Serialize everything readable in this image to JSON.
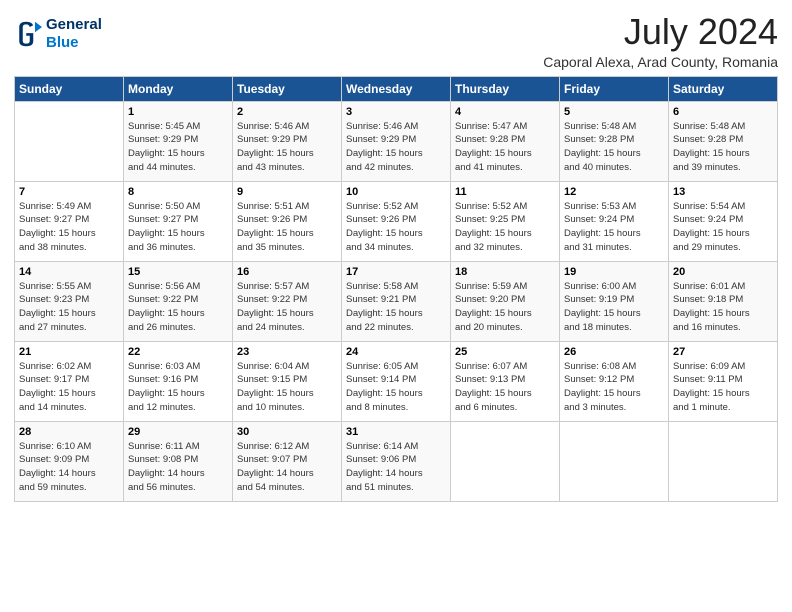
{
  "logo": {
    "line1": "General",
    "line2": "Blue"
  },
  "title": "July 2024",
  "location": "Caporal Alexa, Arad County, Romania",
  "weekdays": [
    "Sunday",
    "Monday",
    "Tuesday",
    "Wednesday",
    "Thursday",
    "Friday",
    "Saturday"
  ],
  "weeks": [
    [
      {
        "day": "",
        "info": ""
      },
      {
        "day": "1",
        "info": "Sunrise: 5:45 AM\nSunset: 9:29 PM\nDaylight: 15 hours\nand 44 minutes."
      },
      {
        "day": "2",
        "info": "Sunrise: 5:46 AM\nSunset: 9:29 PM\nDaylight: 15 hours\nand 43 minutes."
      },
      {
        "day": "3",
        "info": "Sunrise: 5:46 AM\nSunset: 9:29 PM\nDaylight: 15 hours\nand 42 minutes."
      },
      {
        "day": "4",
        "info": "Sunrise: 5:47 AM\nSunset: 9:28 PM\nDaylight: 15 hours\nand 41 minutes."
      },
      {
        "day": "5",
        "info": "Sunrise: 5:48 AM\nSunset: 9:28 PM\nDaylight: 15 hours\nand 40 minutes."
      },
      {
        "day": "6",
        "info": "Sunrise: 5:48 AM\nSunset: 9:28 PM\nDaylight: 15 hours\nand 39 minutes."
      }
    ],
    [
      {
        "day": "7",
        "info": "Sunrise: 5:49 AM\nSunset: 9:27 PM\nDaylight: 15 hours\nand 38 minutes."
      },
      {
        "day": "8",
        "info": "Sunrise: 5:50 AM\nSunset: 9:27 PM\nDaylight: 15 hours\nand 36 minutes."
      },
      {
        "day": "9",
        "info": "Sunrise: 5:51 AM\nSunset: 9:26 PM\nDaylight: 15 hours\nand 35 minutes."
      },
      {
        "day": "10",
        "info": "Sunrise: 5:52 AM\nSunset: 9:26 PM\nDaylight: 15 hours\nand 34 minutes."
      },
      {
        "day": "11",
        "info": "Sunrise: 5:52 AM\nSunset: 9:25 PM\nDaylight: 15 hours\nand 32 minutes."
      },
      {
        "day": "12",
        "info": "Sunrise: 5:53 AM\nSunset: 9:24 PM\nDaylight: 15 hours\nand 31 minutes."
      },
      {
        "day": "13",
        "info": "Sunrise: 5:54 AM\nSunset: 9:24 PM\nDaylight: 15 hours\nand 29 minutes."
      }
    ],
    [
      {
        "day": "14",
        "info": "Sunrise: 5:55 AM\nSunset: 9:23 PM\nDaylight: 15 hours\nand 27 minutes."
      },
      {
        "day": "15",
        "info": "Sunrise: 5:56 AM\nSunset: 9:22 PM\nDaylight: 15 hours\nand 26 minutes."
      },
      {
        "day": "16",
        "info": "Sunrise: 5:57 AM\nSunset: 9:22 PM\nDaylight: 15 hours\nand 24 minutes."
      },
      {
        "day": "17",
        "info": "Sunrise: 5:58 AM\nSunset: 9:21 PM\nDaylight: 15 hours\nand 22 minutes."
      },
      {
        "day": "18",
        "info": "Sunrise: 5:59 AM\nSunset: 9:20 PM\nDaylight: 15 hours\nand 20 minutes."
      },
      {
        "day": "19",
        "info": "Sunrise: 6:00 AM\nSunset: 9:19 PM\nDaylight: 15 hours\nand 18 minutes."
      },
      {
        "day": "20",
        "info": "Sunrise: 6:01 AM\nSunset: 9:18 PM\nDaylight: 15 hours\nand 16 minutes."
      }
    ],
    [
      {
        "day": "21",
        "info": "Sunrise: 6:02 AM\nSunset: 9:17 PM\nDaylight: 15 hours\nand 14 minutes."
      },
      {
        "day": "22",
        "info": "Sunrise: 6:03 AM\nSunset: 9:16 PM\nDaylight: 15 hours\nand 12 minutes."
      },
      {
        "day": "23",
        "info": "Sunrise: 6:04 AM\nSunset: 9:15 PM\nDaylight: 15 hours\nand 10 minutes."
      },
      {
        "day": "24",
        "info": "Sunrise: 6:05 AM\nSunset: 9:14 PM\nDaylight: 15 hours\nand 8 minutes."
      },
      {
        "day": "25",
        "info": "Sunrise: 6:07 AM\nSunset: 9:13 PM\nDaylight: 15 hours\nand 6 minutes."
      },
      {
        "day": "26",
        "info": "Sunrise: 6:08 AM\nSunset: 9:12 PM\nDaylight: 15 hours\nand 3 minutes."
      },
      {
        "day": "27",
        "info": "Sunrise: 6:09 AM\nSunset: 9:11 PM\nDaylight: 15 hours\nand 1 minute."
      }
    ],
    [
      {
        "day": "28",
        "info": "Sunrise: 6:10 AM\nSunset: 9:09 PM\nDaylight: 14 hours\nand 59 minutes."
      },
      {
        "day": "29",
        "info": "Sunrise: 6:11 AM\nSunset: 9:08 PM\nDaylight: 14 hours\nand 56 minutes."
      },
      {
        "day": "30",
        "info": "Sunrise: 6:12 AM\nSunset: 9:07 PM\nDaylight: 14 hours\nand 54 minutes."
      },
      {
        "day": "31",
        "info": "Sunrise: 6:14 AM\nSunset: 9:06 PM\nDaylight: 14 hours\nand 51 minutes."
      },
      {
        "day": "",
        "info": ""
      },
      {
        "day": "",
        "info": ""
      },
      {
        "day": "",
        "info": ""
      }
    ]
  ]
}
